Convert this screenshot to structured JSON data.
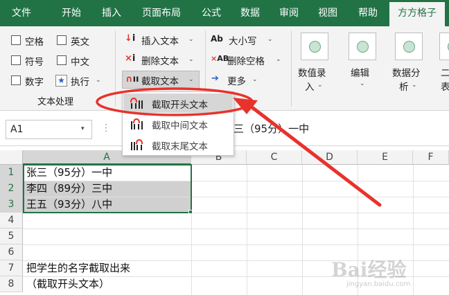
{
  "menu": {
    "tabs": [
      "文件",
      "开始",
      "插入",
      "页面布局",
      "公式",
      "数据",
      "审阅",
      "视图",
      "帮助",
      "方方格子"
    ],
    "active_tab": "方方格子"
  },
  "ribbon": {
    "text_group": {
      "checkboxes": [
        "空格",
        "英文",
        "符号",
        "中文",
        "数字"
      ],
      "execute_label": "执行",
      "group_label": "文本处理"
    },
    "col2": {
      "insert_text": "插入文本",
      "delete_text": "删除文本",
      "extract_text": "截取文本"
    },
    "col3": {
      "case": "大小写",
      "delete_spaces": "删除空格",
      "more": "更多"
    },
    "big_buttons": {
      "value_entry_1": "数值录",
      "value_entry_2": "入",
      "edit": "编辑",
      "data_analysis_1": "数据分",
      "data_analysis_2": "析",
      "partial_1": "二",
      "partial_2": "表"
    }
  },
  "dropdown": {
    "items": [
      "截取开头文本",
      "截取中间文本",
      "截取末尾文本"
    ],
    "highlighted_index": 0
  },
  "formula_bar": {
    "name_box": "A1",
    "content": "张三（95分）一中"
  },
  "grid": {
    "columns": [
      "A",
      "B",
      "C",
      "D",
      "E",
      "F"
    ],
    "rows": [
      "1",
      "2",
      "3",
      "4",
      "5",
      "6",
      "7",
      "8"
    ],
    "cells": {
      "A1": "张三（95分）一中",
      "A2": "李四（89分）三中",
      "A3": "王五（93分）八中",
      "A7": "把学生的名字截取出来",
      "A8": "（截取开头文本）"
    }
  },
  "watermark": {
    "main": "Bai经验",
    "sub": "jingyan.baidu.com"
  },
  "colors": {
    "brand_green": "#217346",
    "annotation_red": "#e8322b",
    "selection_gray": "#d0d0d0"
  }
}
